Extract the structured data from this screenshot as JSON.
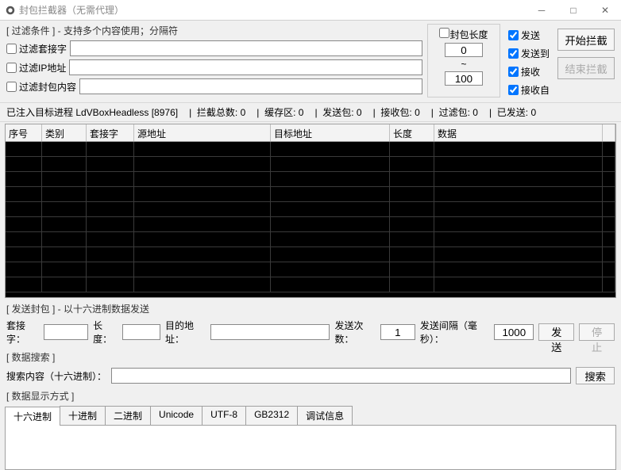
{
  "window": {
    "title": "封包拦截器（无需代理）"
  },
  "filter": {
    "header": "[ 过滤条件 ] - 支持多个内容使用；分隔符",
    "socket_label": "过滤套接字",
    "ip_label": "过滤IP地址",
    "content_label": "过滤封包内容",
    "socket_value": "",
    "ip_value": "",
    "content_value": ""
  },
  "pklen": {
    "label": "封包长度",
    "from": "0",
    "sep": "~",
    "to": "100"
  },
  "checks": {
    "send": "发送",
    "sendto": "发送到",
    "recv": "接收",
    "recvfrom": "接收自"
  },
  "actions": {
    "start": "开始拦截",
    "stop": "结束拦截"
  },
  "status": {
    "injected": "已注入目标进程 LdVBoxHeadless [8976]",
    "total_label": "拦截总数:",
    "total": "0",
    "cache_label": "缓存区:",
    "cache": "0",
    "send_label": "发送包:",
    "send": "0",
    "recv_label": "接收包:",
    "recv": "0",
    "filter_label": "过滤包:",
    "filter": "0",
    "sent_label": "已发送:",
    "sent": "0"
  },
  "columns": {
    "c0": "序号",
    "c1": "类别",
    "c2": "套接字",
    "c3": "源地址",
    "c4": "目标地址",
    "c5": "长度",
    "c6": "数据"
  },
  "sendpk": {
    "header": "[ 发送封包 ] - 以十六进制数据发送",
    "socket_label": "套接字：",
    "socket_value": "",
    "len_label": "长度：",
    "len_value": "",
    "dst_label": "目的地址：",
    "dst_value": "",
    "count_label": "发送次数：",
    "count_value": "1",
    "interval_label": "发送间隔（毫秒）：",
    "interval_value": "1000",
    "send_btn": "发送",
    "stop_btn": "停止"
  },
  "search": {
    "header": "[ 数据搜索 ]",
    "label": "搜索内容（十六进制）：",
    "value": "",
    "btn": "搜索"
  },
  "display": {
    "header": "[ 数据显示方式 ]",
    "tabs": [
      "十六进制",
      "十进制",
      "二进制",
      "Unicode",
      "UTF-8",
      "GB2312",
      "调试信息"
    ]
  }
}
